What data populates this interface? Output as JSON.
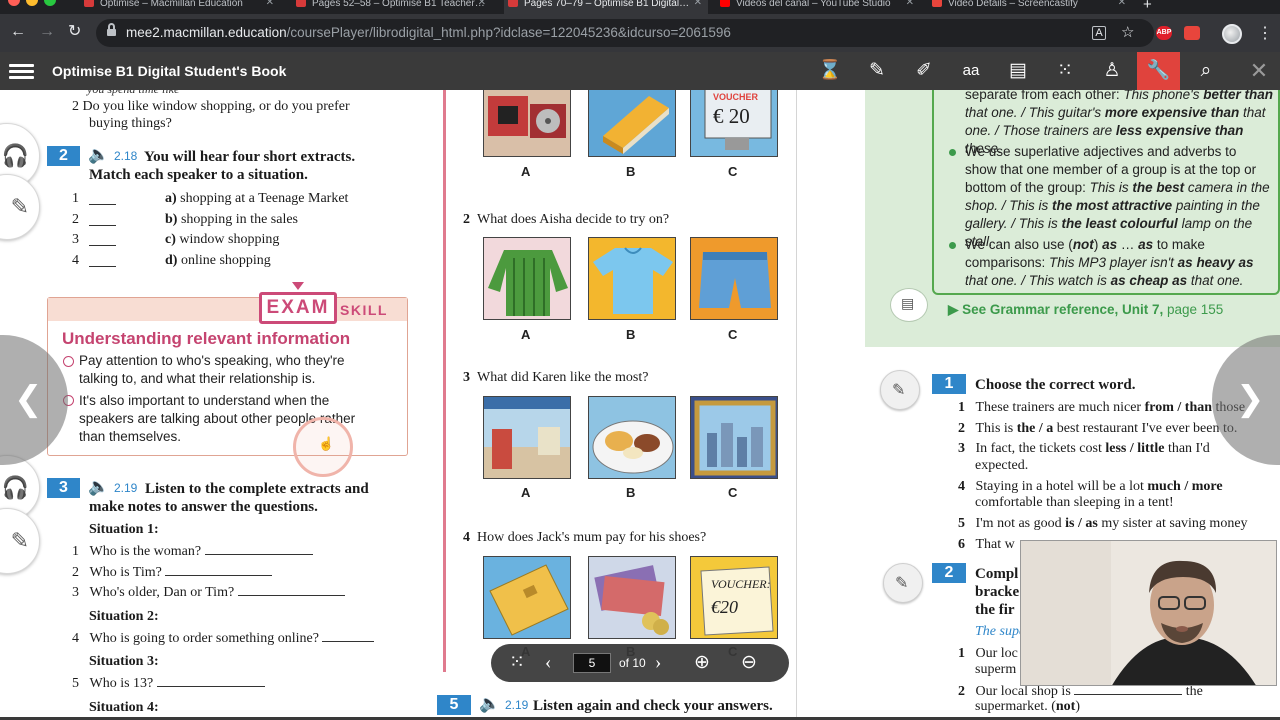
{
  "tabs": [
    {
      "title": "Optimise – Macmillan Education",
      "active": false
    },
    {
      "title": "Pages 52–58 – Optimise B1 Teacher…",
      "active": false
    },
    {
      "title": "Pages 70–79 – Optimise B1 Digital…",
      "active": true
    },
    {
      "title": "Videos del canal – YouTube Studio",
      "active": false
    },
    {
      "title": "Video Details – Screencastify",
      "active": false
    }
  ],
  "address": {
    "host": "mee2.macmillan.education",
    "path": "/coursePlayer/librodigital_html.php?idclase=122045236&idcurso=2061596"
  },
  "extensions": {
    "abp": "ABP"
  },
  "player": {
    "title": "Optimise B1 Digital Student's Book"
  },
  "left": {
    "q2_text": "2  Do you like window shopping, or do you prefer",
    "q2_cont": "buying things?",
    "ex2": {
      "number": "2",
      "track": "2.18",
      "instruction1": "You will hear four short extracts.",
      "instruction2": "Match each speaker to a situation.",
      "nums": [
        "1",
        "2",
        "3",
        "4"
      ],
      "options": [
        {
          "letter": "a)",
          "text": "shopping at a Teenage Market"
        },
        {
          "letter": "b)",
          "text": "shopping in the sales"
        },
        {
          "letter": "c)",
          "text": "window shopping"
        },
        {
          "letter": "d)",
          "text": "online shopping"
        }
      ]
    },
    "exam": {
      "tag": "EXAM",
      "skill": "SKILL",
      "heading": "Understanding relevant information",
      "bullet1_l1": "Pay attention to who's speaking, who they're",
      "bullet1_l2": "talking to, and what their relationship is.",
      "bullet2_l1": "It's also important to understand when the",
      "bullet2_l2": "speakers are talking about other people rather",
      "bullet2_l3": "than themselves."
    },
    "ex3": {
      "number": "3",
      "track": "2.19",
      "instruction1": "Listen to the complete extracts and",
      "instruction2": "make notes to answer the questions.",
      "s1": "Situation 1:",
      "q1": "Who is the woman?",
      "q2": "Who is Tim?",
      "q3": "Who's older, Dan or Tim?",
      "s2": "Situation 2:",
      "q4": "Who is going to order something online?",
      "s3": "Situation 3:",
      "q5": "Who is 13?",
      "s4": "Situation 4:",
      "n1": "1",
      "n2": "2",
      "n3": "3",
      "n4": "4",
      "n5": "5"
    }
  },
  "middle": {
    "labels": {
      "a": "A",
      "b": "B",
      "c": "C"
    },
    "voucher1": "€ 20",
    "q2": {
      "num": "2",
      "text": "What does Aisha decide to try on?"
    },
    "q3": {
      "num": "3",
      "text": "What did Karen like the most?"
    },
    "q4": {
      "num": "4",
      "text": "How does Jack's mum pay for his shoes?"
    },
    "voucher2": "VOUCHER:",
    "voucher2_amount": "€20",
    "ex5": {
      "number": "5",
      "track": "2.19",
      "instruction": "Listen again and check your answers."
    }
  },
  "pager": {
    "page": "5",
    "of": "of 10"
  },
  "right": {
    "g_l1_a": "separate from each other: ",
    "g_l1_b": "This phone's ",
    "g_l1_c": "better than",
    "g_l2_a": "that one. / This guitar's ",
    "g_l2_b": "more expensive than",
    "g_l2_c": " that",
    "g_l3_a": "one. / Those trainers are ",
    "g_l3_b": "less expensive than",
    "g_l3_c": " these.",
    "g_b2_l1": "We use superlative adjectives and adverbs to",
    "g_b2_l2": "show that one member of a group is at the top or",
    "g_b2_l3_a": "bottom of the group: ",
    "g_b2_l3_b": "This is ",
    "g_b2_l3_c": "the best",
    "g_b2_l3_d": " camera in the",
    "g_b2_l4_a": "shop. / This is ",
    "g_b2_l4_b": "the most attractive",
    "g_b2_l4_c": " painting in the",
    "g_b2_l5_a": "gallery. / This is ",
    "g_b2_l5_b": "the least colourful",
    "g_b2_l5_c": " lamp on the stall.",
    "g_b3_l1_a": "We can also use (",
    "g_b3_l1_b": "not",
    "g_b3_l1_c": ") ",
    "g_b3_l1_d": "as",
    "g_b3_l1_e": " … ",
    "g_b3_l1_f": "as",
    "g_b3_l1_g": " to make",
    "g_b3_l2_a": "comparisons: ",
    "g_b3_l2_b": "This MP3 player isn't ",
    "g_b3_l2_c": "as heavy as",
    "g_b3_l3_a": "that one. / This watch is ",
    "g_b3_l3_b": "as cheap as",
    "g_b3_l3_c": " that one.",
    "gref_a": "▶ See Grammar reference, Unit 7, ",
    "gref_b": "page 155",
    "ex1": {
      "number": "1",
      "instruction": "Choose the correct word.",
      "n1": "1",
      "n2": "2",
      "n3": "3",
      "n4": "4",
      "n5": "5",
      "n6": "6",
      "i1_a": "These trainers are much nicer ",
      "i1_b": "from",
      "i1_c": " / ",
      "i1_d": "than",
      "i1_e": " those",
      "i2_a": "This is ",
      "i2_b": "the",
      "i2_c": " / ",
      "i2_d": "a",
      "i2_e": " best restaurant I've ever been to.",
      "i3_a": "In fact, the tickets cost ",
      "i3_b": "less",
      "i3_c": " / ",
      "i3_d": "little",
      "i3_e": " than I'd",
      "i3_l2": "expected.",
      "i4_a": "Staying in a hotel will be a lot ",
      "i4_b": "much",
      "i4_c": " / ",
      "i4_d": "more",
      "i4_l2": "comfortable than sleeping in a tent!",
      "i5_a": "I'm not as good ",
      "i5_b": "is",
      "i5_c": " / ",
      "i5_d": "as",
      "i5_e": " my sister at saving money",
      "i6": "That w"
    },
    "ex2": {
      "number": "2",
      "l1": "Compl",
      "l2": "bracke",
      "l3": "the fir",
      "l4": "The supe",
      "n1": "1",
      "i1": "Our loc",
      "i1_l2": "superm",
      "n2": "2",
      "i2_a": "Our local shop is ",
      "i2_b": " the",
      "i2_l2_a": "supermarket. (",
      "i2_l2_b": "not",
      "i2_l2_c": ")"
    }
  },
  "colors": {
    "exercise_blue": "#2f86c9",
    "exam_pink": "#cc4a78",
    "grammar_green": "#3c9a4b",
    "active_tool": "#e0433d"
  }
}
